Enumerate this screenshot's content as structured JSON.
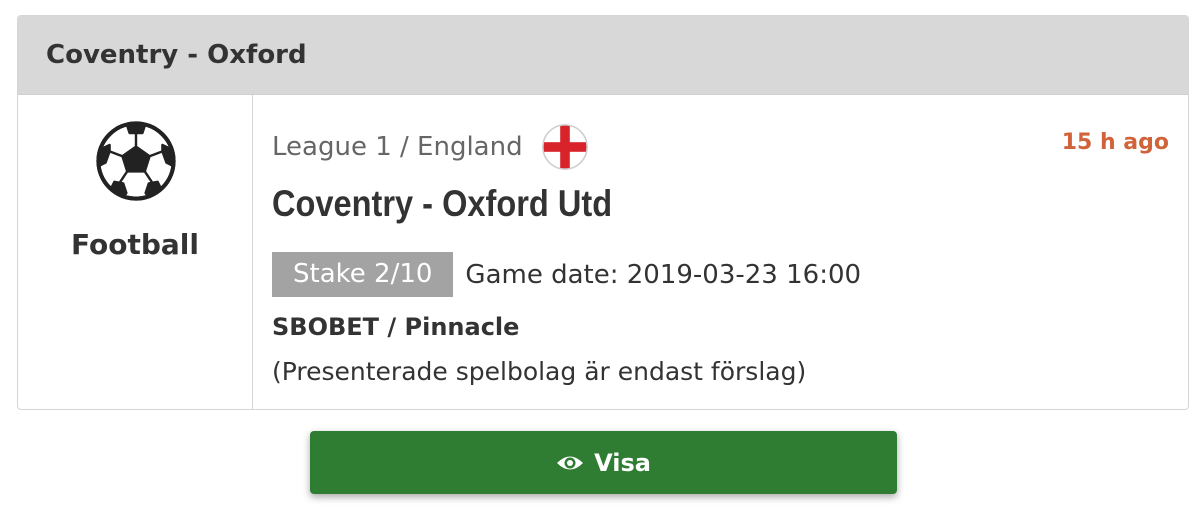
{
  "header": {
    "title": "Coventry - Oxford"
  },
  "sport": {
    "icon": "soccer-ball-icon",
    "label": "Football"
  },
  "match": {
    "league": "League 1 / England",
    "flag_icon": "england-flag-icon",
    "time_ago": "15 h ago",
    "title": "Coventry - Oxford Utd",
    "stake": "Stake 2/10",
    "game_date": "Game date: 2019-03-23 16:00",
    "bookmakers": "SBOBET / Pinnacle",
    "disclaimer": "(Presenterade spelbolag är endast förslag)"
  },
  "action": {
    "icon": "eye-icon",
    "label": "Visa"
  },
  "colors": {
    "header_bg": "#d8d8d8",
    "time_ago": "#d0633a",
    "stake_badge": "#a3a3a3",
    "button": "#2f7d32"
  }
}
